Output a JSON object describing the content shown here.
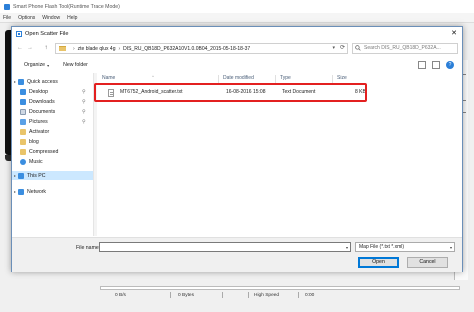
{
  "app": {
    "title": "Smart Phone Flash Tool(Runtime Trace Mode)",
    "menu": [
      "File",
      "Options",
      "Window",
      "Help"
    ],
    "status": {
      "speed": "0 B/s",
      "bytes": "0 Bytes",
      "mode": "High Speed",
      "time": "0:00"
    }
  },
  "dialog": {
    "title": "Open Scatter File",
    "close_glyph": "✕",
    "back_glyph": "←",
    "forward_glyph": "→",
    "up_glyph": "↑",
    "breadcrumb": [
      "zte blade qlux 4g",
      "DIS_RU_QB18D_P632A10V1.0.0B04_2015-05-18-18-37"
    ],
    "crumb_separator": "›",
    "search_placeholder": "Search DIS_RU_QB18D_P632A...",
    "toolbar": {
      "organize": "Organize",
      "organize_caret": "▾",
      "new_folder": "New folder",
      "help_glyph": "?"
    },
    "navpane": [
      {
        "label": "Quick access",
        "icon": "star-icon",
        "pinned": false,
        "expander": "▸"
      },
      {
        "label": "Desktop",
        "icon": "desktop-icon",
        "pinned": true
      },
      {
        "label": "Downloads",
        "icon": "downloads-icon",
        "pinned": true
      },
      {
        "label": "Documents",
        "icon": "documents-icon",
        "pinned": true
      },
      {
        "label": "Pictures",
        "icon": "pictures-icon",
        "pinned": true
      },
      {
        "label": "Activator",
        "icon": "folder-icon",
        "pinned": false
      },
      {
        "label": "blog",
        "icon": "folder-icon",
        "pinned": false
      },
      {
        "label": "Compressed",
        "icon": "folder-icon",
        "pinned": false
      },
      {
        "label": "Music",
        "icon": "music-icon",
        "pinned": false
      },
      {
        "label": "This PC",
        "icon": "pc-icon",
        "pinned": false,
        "selected": true,
        "expander": "▸"
      },
      {
        "label": "Network",
        "icon": "network-icon",
        "pinned": false,
        "expander": "▸"
      }
    ],
    "pin_glyph": "📌",
    "columns": [
      "Name",
      "Date modified",
      "Type",
      "Size"
    ],
    "sort_arrow": "^",
    "files": [
      {
        "name": "MT6752_Android_scatter.txt",
        "date": "16-08-2016 15:08",
        "type": "Text Document",
        "size": "8 KB"
      }
    ],
    "filename_label": "File name:",
    "filename_value": "",
    "filetype_value": "Map File (*.txt *.xml)",
    "dropdown_glyph": "▾",
    "open_button": "Open",
    "cancel_button": "Cancel"
  },
  "colors": {
    "accent": "#0078d7",
    "selection": "#cce8ff",
    "highlight_box": "#e32020",
    "folder": "#e9c46a"
  }
}
